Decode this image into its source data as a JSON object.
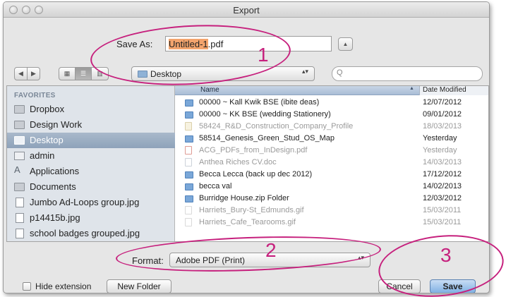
{
  "window": {
    "title": "Export"
  },
  "save_as": {
    "label": "Save As:",
    "filename_selected": "Untitled-1",
    "filename_ext": ".pdf",
    "expand_glyph": "▲"
  },
  "toolbar": {
    "back_glyph": "◀",
    "forward_glyph": "▶",
    "icon_view_glyph": "▦",
    "list_view_glyph": "☰",
    "column_view_glyph": "▥",
    "location": "Desktop",
    "updown_glyph": "▴▾",
    "search_placeholder": "",
    "search_glyph": "Q"
  },
  "sidebar": {
    "heading": "FAVORITES",
    "items": [
      {
        "label": "Dropbox",
        "icon": "folder-icon"
      },
      {
        "label": "Design Work",
        "icon": "folder-icon"
      },
      {
        "label": "Desktop",
        "icon": "folder-icon",
        "selected": true
      },
      {
        "label": "admin",
        "icon": "home-icon"
      },
      {
        "label": "Applications",
        "icon": "applications-icon",
        "glyph": "A"
      },
      {
        "label": "Documents",
        "icon": "documents-icon"
      },
      {
        "label": "Jumbo Ad-Loops group.jpg",
        "icon": "image-file-icon"
      },
      {
        "label": "p14415b.jpg",
        "icon": "image-file-icon"
      },
      {
        "label": "school badges grouped.jpg",
        "icon": "image-file-icon"
      }
    ]
  },
  "filelist": {
    "columns": {
      "name": "Name",
      "sort_glyph": "▲",
      "date": "Date Modified"
    },
    "rows": [
      {
        "name": "00000 ~ Kall Kwik BSE (ibite deas)",
        "date": "12/07/2012",
        "type": "folder",
        "enabled": true
      },
      {
        "name": "00000 ~ KK BSE (wedding Stationery)",
        "date": "09/01/2012",
        "type": "folder",
        "enabled": true
      },
      {
        "name": "58424_R&D_Construction_Company_Profile",
        "date": "18/03/2013",
        "type": "zip",
        "enabled": false
      },
      {
        "name": "58514_Genesis_Green_Stud_OS_Map",
        "date": "Yesterday",
        "type": "folder",
        "enabled": true
      },
      {
        "name": "ACG_PDFs_from_InDesign.pdf",
        "date": "Yesterday",
        "type": "pdf",
        "enabled": false
      },
      {
        "name": "Anthea Riches CV.doc",
        "date": "14/03/2013",
        "type": "doc",
        "enabled": false
      },
      {
        "name": "Becca Lecca (back up dec 2012)",
        "date": "17/12/2012",
        "type": "folder",
        "enabled": true
      },
      {
        "name": "becca val",
        "date": "14/02/2013",
        "type": "folder",
        "enabled": true
      },
      {
        "name": "Burridge House.zip Folder",
        "date": "12/03/2012",
        "type": "folder",
        "enabled": true
      },
      {
        "name": "Harriets_Bury-St_Edmunds.gif",
        "date": "15/03/2011",
        "type": "gif",
        "enabled": false
      },
      {
        "name": "Harriets_Cafe_Tearooms.gif",
        "date": "15/03/2011",
        "type": "gif",
        "enabled": false
      }
    ]
  },
  "format": {
    "label": "Format:",
    "value": "Adobe PDF (Print)",
    "updown_glyph": "▴▾"
  },
  "footer": {
    "hide_extension_label": "Hide extension",
    "new_folder_label": "New Folder",
    "cancel_label": "Cancel",
    "save_label": "Save"
  },
  "annotations": {
    "one": "1",
    "two": "2",
    "three": "3",
    "color": "#c6207d"
  }
}
